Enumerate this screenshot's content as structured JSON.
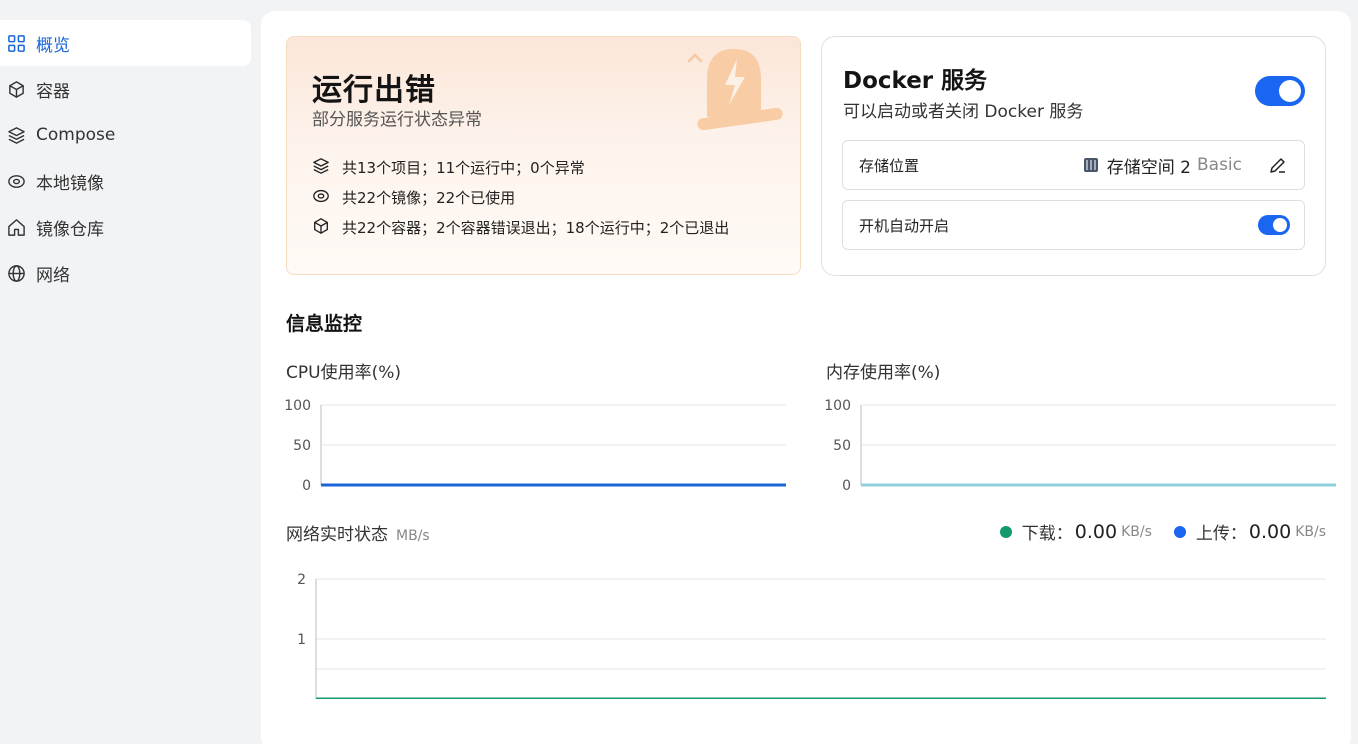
{
  "sidebar": {
    "items": [
      {
        "label": "概览",
        "icon": "grid-icon",
        "active": true
      },
      {
        "label": "容器",
        "icon": "box-icon"
      },
      {
        "label": "Compose",
        "icon": "layers-icon"
      },
      {
        "label": "本地镜像",
        "icon": "disc-icon"
      },
      {
        "label": "镜像仓库",
        "icon": "home-icon"
      },
      {
        "label": "网络",
        "icon": "globe-icon"
      }
    ]
  },
  "status_card": {
    "title": "运行出错",
    "subtitle": "部分服务运行状态异常",
    "lines": [
      "共13个项目；11个运行中；0个异常",
      "共22个镜像；22个已使用",
      "共22个容器；2个容器错误退出；18个运行中；2个已退出"
    ]
  },
  "docker_card": {
    "title": "Docker 服务",
    "subtitle": "可以启动或者关闭 Docker 服务",
    "enabled": true,
    "storage_label": "存储位置",
    "storage_value": "存储空间 2",
    "storage_type": "Basic",
    "autostart_label": "开机自动开启",
    "autostart_enabled": true
  },
  "monitor": {
    "title": "信息监控",
    "cpu_title": "CPU使用率(%)",
    "mem_title": "内存使用率(%)",
    "net_title": "网络实时状态",
    "net_unit": "MB/s",
    "download_label": "下载：",
    "download_value": "0.00",
    "upload_label": "上传：",
    "upload_value": "0.00",
    "rate_unit": "KB/s"
  },
  "colors": {
    "accent": "#1a66f0",
    "cpu_line": "#1a66d8",
    "mem_line": "#8fd0dc",
    "download": "#129a6a",
    "upload": "#1a66f0"
  },
  "chart_data": [
    {
      "type": "line",
      "title": "CPU使用率(%)",
      "ylim": [
        0,
        100
      ],
      "yticks": [
        "100",
        "50",
        "0"
      ],
      "series": [
        {
          "values": [
            0,
            0,
            0,
            0,
            0,
            0,
            0,
            0,
            0,
            0,
            0,
            0
          ]
        }
      ]
    },
    {
      "type": "line",
      "title": "内存使用率(%)",
      "ylim": [
        0,
        100
      ],
      "yticks": [
        "100",
        "50",
        "0"
      ],
      "series": [
        {
          "values": [
            0,
            0,
            0,
            0,
            0,
            0,
            0,
            0,
            0,
            0,
            0,
            0
          ]
        }
      ]
    },
    {
      "type": "line",
      "title": "网络实时状态",
      "ylim": [
        0,
        2
      ],
      "yticks": [
        "2",
        "1"
      ],
      "series": [
        {
          "name": "下载",
          "values": [
            0,
            0,
            0,
            0,
            0,
            0,
            0,
            0,
            0,
            0,
            0,
            0
          ]
        },
        {
          "name": "上传",
          "values": [
            0,
            0,
            0,
            0,
            0,
            0,
            0,
            0,
            0,
            0,
            0,
            0
          ]
        }
      ]
    }
  ]
}
